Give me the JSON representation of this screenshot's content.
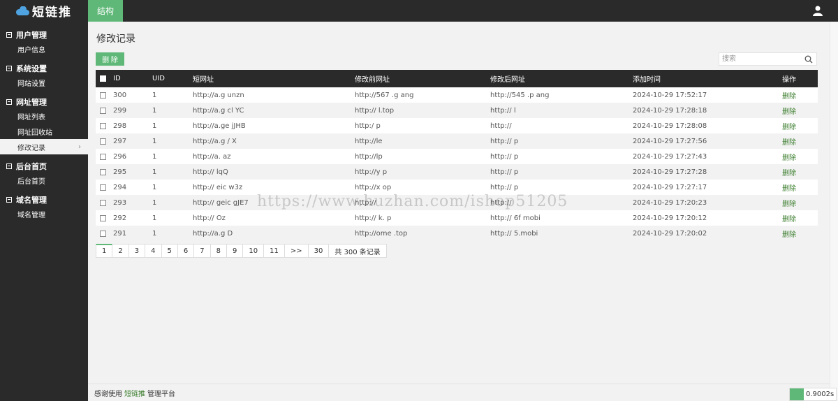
{
  "app": {
    "logo_text": "短链推",
    "top_tab": "结构"
  },
  "sidebar": {
    "groups": [
      {
        "label": "用户管理",
        "items": [
          "用户信息"
        ]
      },
      {
        "label": "系统设置",
        "items": [
          "网站设置"
        ]
      },
      {
        "label": "网址管理",
        "items": [
          "网址列表",
          "网址回收站",
          "修改记录"
        ]
      },
      {
        "label": "后台首页",
        "items": [
          "后台首页"
        ]
      },
      {
        "label": "域名管理",
        "items": [
          "域名管理"
        ]
      }
    ],
    "active_item": "修改记录",
    "active_arrow": "›"
  },
  "main": {
    "title": "修改记录",
    "delete_button": "删 除",
    "search_placeholder": "搜索"
  },
  "table": {
    "headers": [
      "ID",
      "UID",
      "短网址",
      "修改前网址",
      "修改后网址",
      "添加时间",
      "操作"
    ],
    "rows": [
      [
        "300",
        "1",
        "http://a.g      unzn",
        "http://567   .g  ang",
        "http://545   .p  ang",
        "2024-10-29 17:52:17",
        "删除"
      ],
      [
        "299",
        "1",
        "http://a.g cl      YC",
        "http://      l.top",
        "http://      l  ",
        "2024-10-29 17:28:18",
        "删除"
      ],
      [
        "298",
        "1",
        "http://a.ge      jJHB",
        "http:/      p",
        "http://      ",
        "2024-10-29 17:28:08",
        "删除"
      ],
      [
        "297",
        "1",
        "http://a.g    /   X",
        "http://le      ",
        "http://      p",
        "2024-10-29 17:27:56",
        "删除"
      ],
      [
        "296",
        "1",
        "http://a.     az",
        "http://lp      ",
        "http://      p",
        "2024-10-29 17:27:43",
        "删除"
      ],
      [
        "295",
        "1",
        "http://      lqQ",
        "http://y      p",
        "http://      p",
        "2024-10-29 17:27:28",
        "删除"
      ],
      [
        "294",
        "1",
        "http://  eic    w3z",
        "http://x      op",
        "http://      p",
        "2024-10-29 17:27:17",
        "删除"
      ],
      [
        "293",
        "1",
        "http://  geic     gJE7",
        "http://      ",
        "http://      ",
        "2024-10-29 17:20:23",
        "删除"
      ],
      [
        "292",
        "1",
        "http://      Oz",
        "http://     k.  p",
        "http://      6f  mobi",
        "2024-10-29 17:20:12",
        "删除"
      ],
      [
        "291",
        "1",
        "http://a.g      D",
        "http://ome    .top",
        "http://    5.mobi",
        "2024-10-29 17:20:02",
        "删除"
      ]
    ]
  },
  "pagination": {
    "pages": [
      "1",
      "2",
      "3",
      "4",
      "5",
      "6",
      "7",
      "8",
      "9",
      "10",
      "11",
      ">>",
      "30"
    ],
    "current": "1",
    "total": "共 300 条记录"
  },
  "footer": {
    "prefix": "感谢使用",
    "brand": "短链推",
    "suffix": "管理平台"
  },
  "timer": "0.9002s",
  "watermark": "https://www.huzhan.com/ishop51205",
  "colors": {
    "accent": "#5fb878",
    "dark": "#2a2a2a",
    "link": "#3a7d2c"
  }
}
